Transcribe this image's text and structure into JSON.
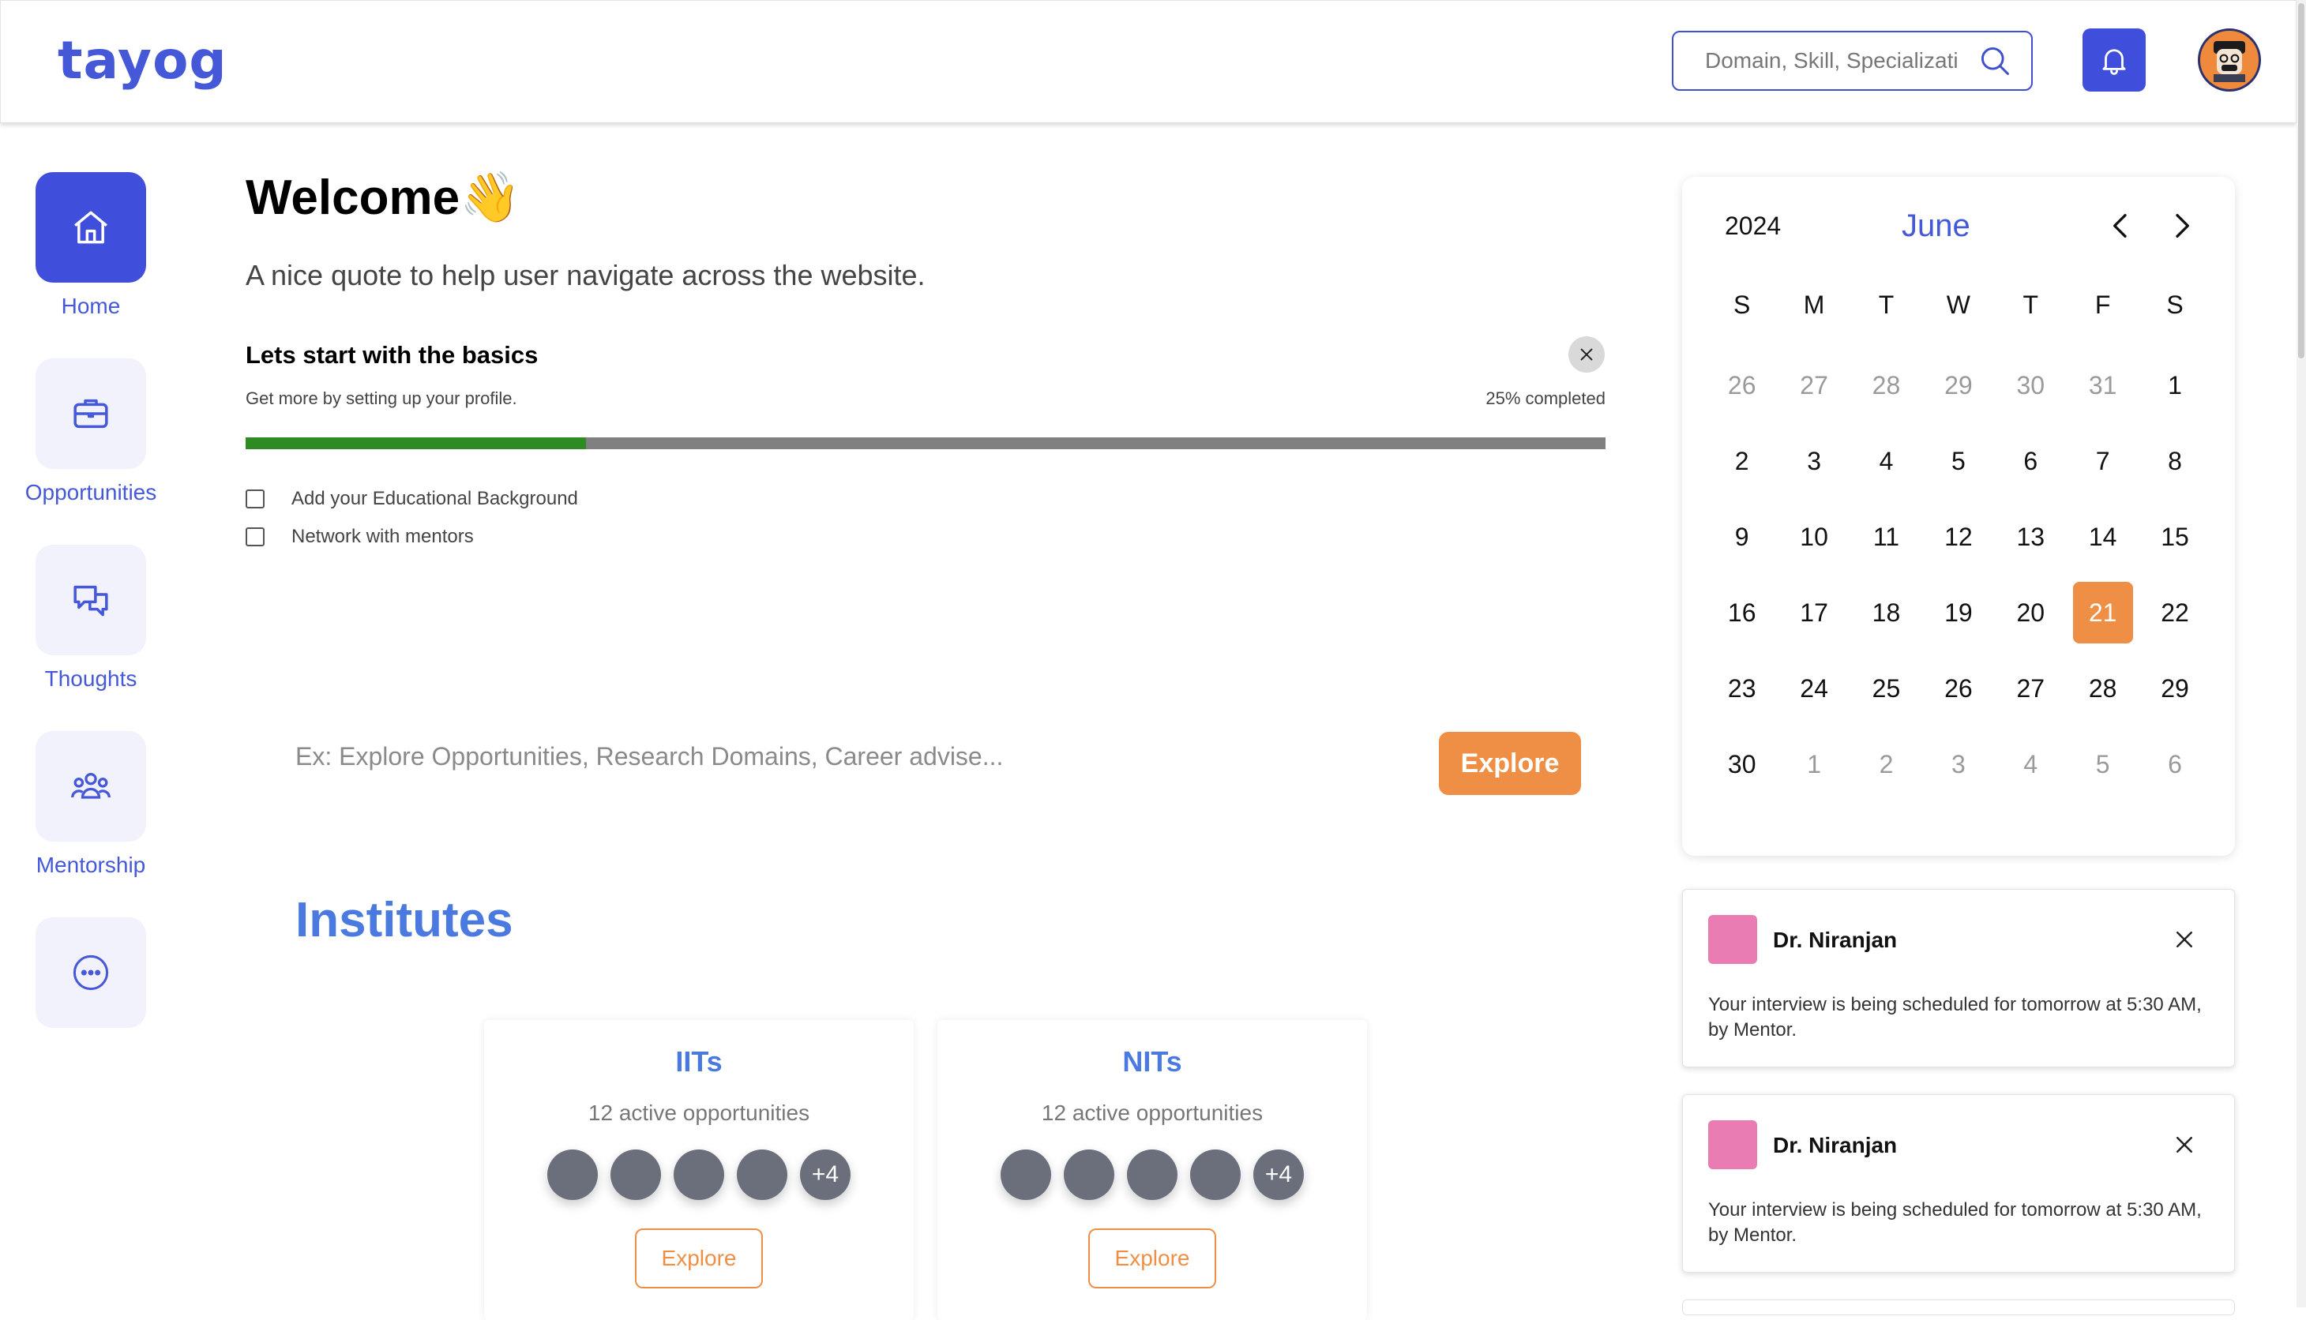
{
  "header": {
    "logo": "tayog",
    "search_placeholder": "Domain, Skill, Specialization",
    "search_icon": "search-icon",
    "bell_icon": "bell-icon",
    "avatar_icon": "avatar"
  },
  "sidebar": {
    "items": [
      {
        "label": "Home",
        "icon": "home-icon",
        "active": true
      },
      {
        "label": "Opportunities",
        "icon": "briefcase-icon",
        "active": false
      },
      {
        "label": "Thoughts",
        "icon": "chat-icon",
        "active": false
      },
      {
        "label": "Mentorship",
        "icon": "people-icon",
        "active": false
      },
      {
        "label": "",
        "icon": "more-icon",
        "active": false
      }
    ]
  },
  "main": {
    "welcome": "Welcome👋",
    "quote": "A nice quote to help user navigate across the website.",
    "basics": {
      "title": "Lets start with the basics",
      "subtitle": "Get more by setting up your profile.",
      "completed_text": "25% completed",
      "progress_fraction": 0.25,
      "tasks": [
        "Add your Educational Background",
        "Network with mentors"
      ]
    },
    "explore": {
      "placeholder": "Ex: Explore Opportunities, Research Domains, Career advise...",
      "button": "Explore"
    },
    "institutes": {
      "title": "Institutes",
      "cards": [
        {
          "name": "IITs",
          "subtitle": "12 active opportunities",
          "more": "+4",
          "button": "Explore"
        },
        {
          "name": "NITs",
          "subtitle": "12 active opportunities",
          "more": "+4",
          "button": "Explore"
        }
      ]
    }
  },
  "calendar": {
    "year": "2024",
    "month": "June",
    "weekdays": [
      "S",
      "M",
      "T",
      "W",
      "T",
      "F",
      "S"
    ],
    "days": [
      [
        "26",
        "muted"
      ],
      [
        "27",
        "muted"
      ],
      [
        "28",
        "muted"
      ],
      [
        "29",
        "muted"
      ],
      [
        "30",
        "muted"
      ],
      [
        "31",
        "muted"
      ],
      [
        "1",
        ""
      ],
      [
        "2",
        ""
      ],
      [
        "3",
        ""
      ],
      [
        "4",
        ""
      ],
      [
        "5",
        ""
      ],
      [
        "6",
        ""
      ],
      [
        "7",
        ""
      ],
      [
        "8",
        ""
      ],
      [
        "9",
        ""
      ],
      [
        "10",
        ""
      ],
      [
        "11",
        ""
      ],
      [
        "12",
        ""
      ],
      [
        "13",
        ""
      ],
      [
        "14",
        ""
      ],
      [
        "15",
        ""
      ],
      [
        "16",
        ""
      ],
      [
        "17",
        ""
      ],
      [
        "18",
        ""
      ],
      [
        "19",
        ""
      ],
      [
        "20",
        ""
      ],
      [
        "21",
        "today"
      ],
      [
        "22",
        ""
      ],
      [
        "23",
        ""
      ],
      [
        "24",
        ""
      ],
      [
        "25",
        ""
      ],
      [
        "26",
        ""
      ],
      [
        "27",
        ""
      ],
      [
        "28",
        ""
      ],
      [
        "29",
        ""
      ],
      [
        "30",
        ""
      ],
      [
        "1",
        "muted"
      ],
      [
        "2",
        "muted"
      ],
      [
        "3",
        "muted"
      ],
      [
        "4",
        "muted"
      ],
      [
        "5",
        "muted"
      ],
      [
        "6",
        "muted"
      ]
    ]
  },
  "notifications": [
    {
      "name": "Dr. Niranjan",
      "message": "Your interview is being scheduled for tomorrow at 5:30 AM, by Mentor."
    },
    {
      "name": "Dr. Niranjan",
      "message": "Your interview is being scheduled for tomorrow at 5:30 AM, by Mentor."
    }
  ],
  "colors": {
    "primary": "#3f4fdc",
    "accent": "#ef8f45",
    "progress": "#2e8b22",
    "institute_title": "#4a7ae0"
  }
}
